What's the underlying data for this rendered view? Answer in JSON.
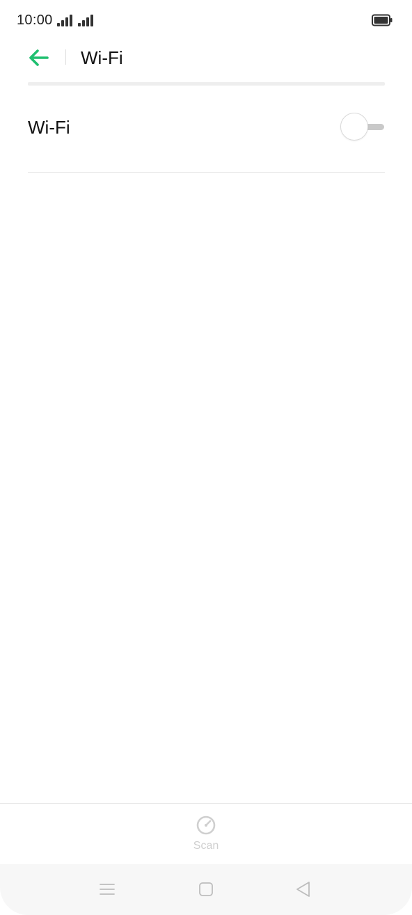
{
  "status_bar": {
    "time": "10:00",
    "signal_icons": [
      "signal-bars-icon",
      "signal-bars-icon"
    ],
    "battery_icon": "battery-icon"
  },
  "header": {
    "back_icon": "arrow-left-icon",
    "title": "Wi-Fi"
  },
  "wifi_row": {
    "label": "Wi-Fi",
    "toggle_on": false
  },
  "bottom_bar": {
    "scan_icon": "scan-gauge-icon",
    "scan_label": "Scan"
  },
  "nav_bar": {
    "items": [
      "menu-icon",
      "home-square-icon",
      "back-triangle-icon"
    ]
  },
  "colors": {
    "accent": "#1fbf6f",
    "text": "#111111",
    "muted": "#cfcfcf",
    "divider": "#e3e3e3"
  }
}
